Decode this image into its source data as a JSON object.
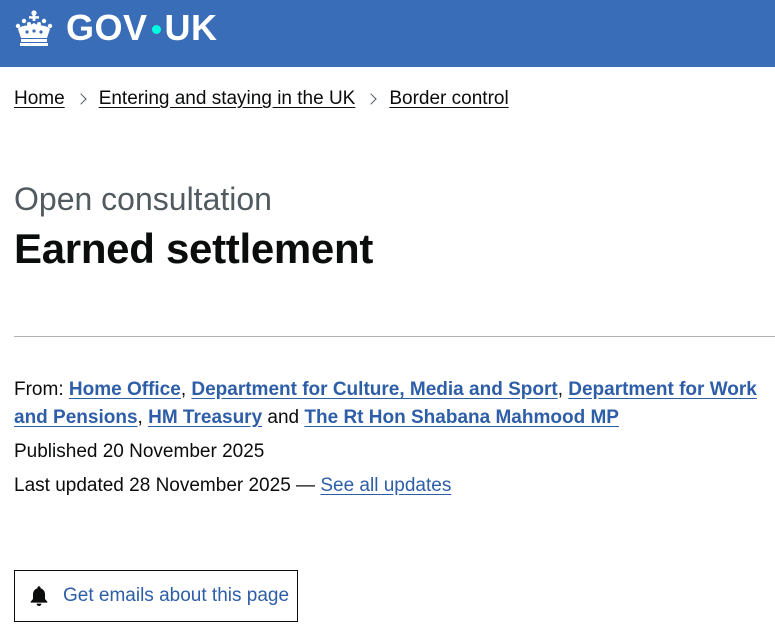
{
  "header": {
    "logo_part1": "GOV",
    "logo_part2": "UK",
    "crown_icon": "crown-icon",
    "background_color": "#3a6db8"
  },
  "breadcrumbs": [
    "Home",
    "Entering and staying in the UK",
    "Border control"
  ],
  "page": {
    "caption": "Open consultation",
    "title": "Earned settlement"
  },
  "metadata": {
    "from_label": "From:",
    "organisations": [
      "Home Office",
      "Department for Culture, Media and Sport",
      "Department for Work and Pensions",
      "HM Treasury",
      "The Rt Hon Shabana Mahmood MP"
    ],
    "sep_comma": ",",
    "sep_and": "and",
    "published_label": "Published",
    "published_date": "20 November 2025",
    "updated_label": "Last updated",
    "updated_date": "28 November 2025",
    "updated_dash": "—",
    "see_all_updates": "See all updates"
  },
  "subscribe": {
    "label": "Get emails about this page",
    "icon": "bell-icon"
  },
  "colors": {
    "link": "#2d5ea7",
    "text": "#0b0c0c",
    "secondary": "#505a5f"
  }
}
